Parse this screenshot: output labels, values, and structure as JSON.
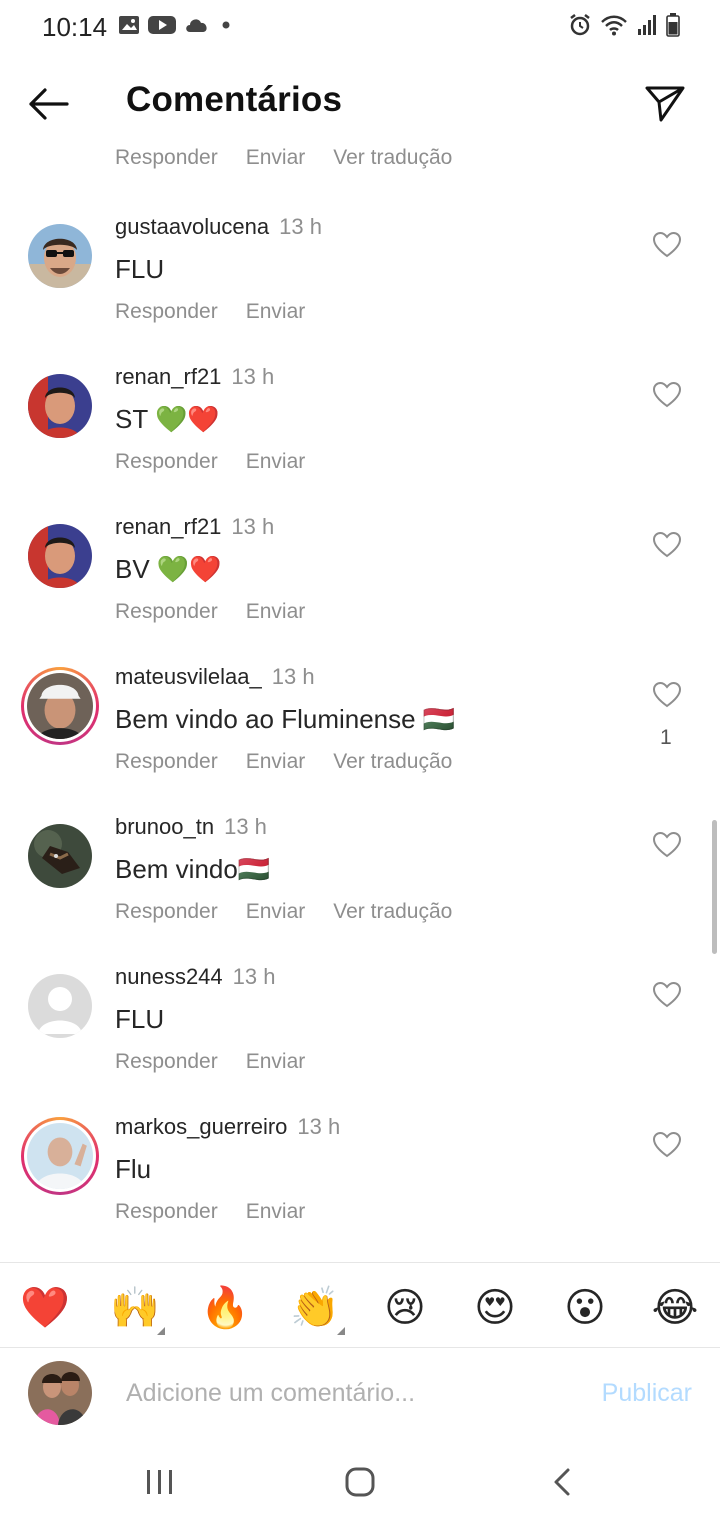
{
  "status_bar": {
    "time": "10:14",
    "left_icons": [
      "gallery-icon",
      "youtube-icon",
      "cloud-icon",
      "dot-icon"
    ],
    "right_icons": [
      "alarm-icon",
      "wifi-icon",
      "signal-icon",
      "battery-icon"
    ]
  },
  "header": {
    "title": "Comentários",
    "back_icon": "arrow-left-icon",
    "send_icon": "paper-plane-icon"
  },
  "top_partial_actions": {
    "reply": "Responder",
    "send": "Enviar",
    "translate": "Ver tradução"
  },
  "comments": [
    {
      "username": "gustaavolucena",
      "time": "13 h",
      "text": "FLU",
      "reply": "Responder",
      "send": "Enviar",
      "translate": "",
      "likes": "",
      "story_ring": false
    },
    {
      "username": "renan_rf21",
      "time": "13 h",
      "text": "ST 💚❤️",
      "reply": "Responder",
      "send": "Enviar",
      "translate": "",
      "likes": "",
      "story_ring": false
    },
    {
      "username": "renan_rf21",
      "time": "13 h",
      "text": "BV 💚❤️",
      "reply": "Responder",
      "send": "Enviar",
      "translate": "",
      "likes": "",
      "story_ring": false
    },
    {
      "username": "mateusvilelaa_",
      "time": "13 h",
      "text": "Bem vindo ao Fluminense 🇭🇺",
      "reply": "Responder",
      "send": "Enviar",
      "translate": "Ver tradução",
      "likes": "1",
      "story_ring": true
    },
    {
      "username": "brunoo_tn",
      "time": "13 h",
      "text": "Bem vindo🇭🇺",
      "reply": "Responder",
      "send": "Enviar",
      "translate": "Ver tradução",
      "likes": "",
      "story_ring": false
    },
    {
      "username": "nuness244",
      "time": "13 h",
      "text": "FLU",
      "reply": "Responder",
      "send": "Enviar",
      "translate": "",
      "likes": "",
      "story_ring": false
    },
    {
      "username": "markos_guerreiro",
      "time": "13 h",
      "text": "Flu",
      "reply": "Responder",
      "send": "Enviar",
      "translate": "",
      "likes": "",
      "story_ring": true
    }
  ],
  "emoji_bar": [
    "❤️",
    "🙌",
    "🔥",
    "👏",
    "😢",
    "😍",
    "😮",
    "😂"
  ],
  "comment_input": {
    "placeholder": "Adicione um comentário...",
    "publish_label": "Publicar"
  },
  "colors": {
    "secondary_text": "#8e8e8e",
    "publish_disabled": "#b3dbff",
    "story_ring_start": "#f9a03f",
    "story_ring_end": "#c13584"
  }
}
